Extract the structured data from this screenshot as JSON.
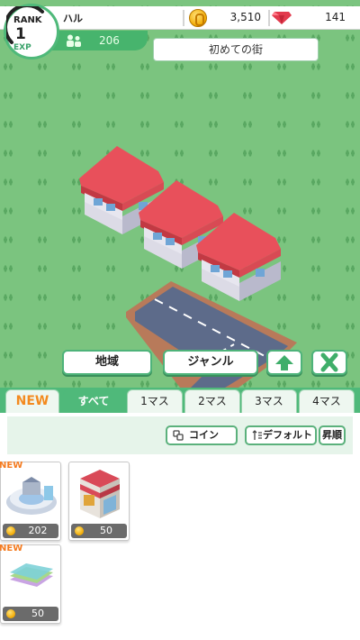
{
  "hud": {
    "rank_label": "RANK",
    "rank_value": "1",
    "exp_label": "EXP",
    "player_name": "ハル",
    "coins": "3,510",
    "gems": "141",
    "population": "206",
    "town_name": "初めての街",
    "icons": {
      "coin": "coin-icon",
      "gem": "gem-icon",
      "population": "people-icon"
    }
  },
  "controls": {
    "region_label": "地域",
    "genre_label": "ジャンル",
    "up_icon": "arrow-up-icon",
    "close_icon": "close-x-icon"
  },
  "tabs": [
    {
      "label": "NEW"
    },
    {
      "label": "すべて",
      "selected": true
    },
    {
      "label": "1マス"
    },
    {
      "label": "2マス"
    },
    {
      "label": "3マス"
    },
    {
      "label": "4マス"
    }
  ],
  "sort": {
    "coin_label": "コイン",
    "default_label": "デフォルト",
    "order_label": "昇順"
  },
  "items": [
    {
      "badge": "NEW",
      "price": "202",
      "art": "stadium-building"
    },
    {
      "badge": "",
      "price": "50",
      "art": "shop-building"
    },
    {
      "badge": "NEW",
      "price": "50",
      "art": "colored-tiles"
    }
  ],
  "colors": {
    "accent_green": "#4fb97a",
    "grass": "#7bc47f",
    "roof_red": "#e8505b",
    "new_orange": "#f47b20"
  }
}
